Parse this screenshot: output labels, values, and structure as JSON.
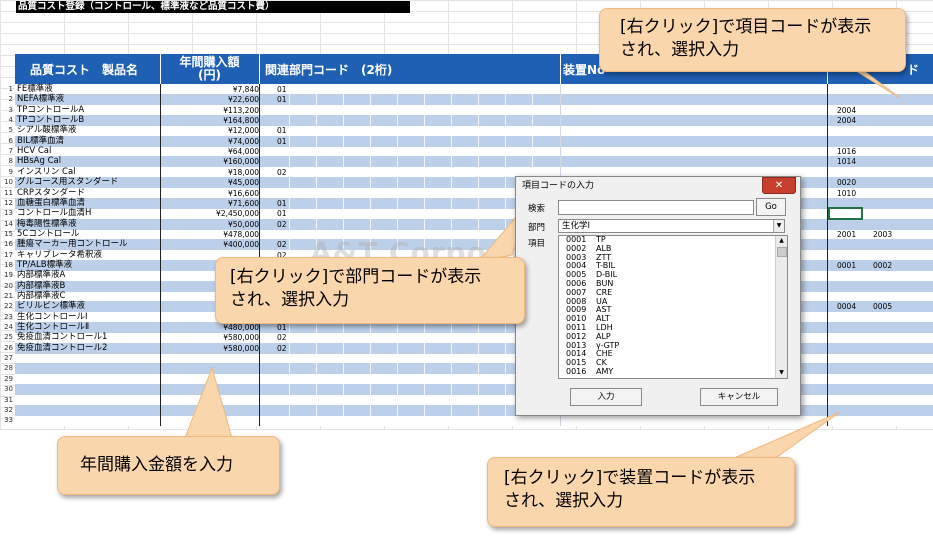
{
  "sheet_title": "品質コスト登録（コントロール、標準液など品質コスト費）",
  "headers": {
    "product": "品質コスト　製品名",
    "amount_line1": "年間購入額",
    "amount_line2": "(円)",
    "dept": "関連部門コード　(2桁)",
    "device": "装置No",
    "item_tail": "ド"
  },
  "rows": [
    {
      "num": "1",
      "name": "FE標準液",
      "amt": "¥7,840",
      "dept": "01",
      "c1": "",
      "c2": ""
    },
    {
      "num": "2",
      "name": "NEFA標準液",
      "amt": "¥22,600",
      "dept": "01",
      "c1": "",
      "c2": ""
    },
    {
      "num": "3",
      "name": "TPコントロールA",
      "amt": "¥113,200",
      "dept": "",
      "c1": "2004",
      "c2": ""
    },
    {
      "num": "4",
      "name": "TPコントロールB",
      "amt": "¥164,800",
      "dept": "",
      "c1": "2004",
      "c2": ""
    },
    {
      "num": "5",
      "name": "シアル酸標準液",
      "amt": "¥12,000",
      "dept": "01",
      "c1": "",
      "c2": ""
    },
    {
      "num": "6",
      "name": "BIL標準血清",
      "amt": "¥74,000",
      "dept": "01",
      "c1": "",
      "c2": ""
    },
    {
      "num": "7",
      "name": "HCV Cal",
      "amt": "¥64,000",
      "dept": "",
      "c1": "1016",
      "c2": ""
    },
    {
      "num": "8",
      "name": "HBsAg Cal",
      "amt": "¥160,000",
      "dept": "",
      "c1": "1014",
      "c2": ""
    },
    {
      "num": "9",
      "name": "インスリン Cal",
      "amt": "¥18,000",
      "dept": "02",
      "c1": "",
      "c2": ""
    },
    {
      "num": "10",
      "name": "グルコース用スタンダード",
      "amt": "¥45,000",
      "dept": "",
      "c1": "0020",
      "c2": ""
    },
    {
      "num": "11",
      "name": "CRPスタンダード",
      "amt": "¥16,600",
      "dept": "",
      "c1": "1010",
      "c2": ""
    },
    {
      "num": "12",
      "name": "血糖蛋白標準血清",
      "amt": "¥71,600",
      "dept": "01",
      "c1": "",
      "c2": ""
    },
    {
      "num": "13",
      "name": "コントロール血清H",
      "amt": "¥2,450,000",
      "dept": "01",
      "c1": "",
      "c2": ""
    },
    {
      "num": "14",
      "name": "梅毒陽性標準液",
      "amt": "¥50,000",
      "dept": "02",
      "c1": "",
      "c2": ""
    },
    {
      "num": "15",
      "name": "5Cコントロール",
      "amt": "¥478,000",
      "dept": "",
      "c1": "2001",
      "c2": "2003"
    },
    {
      "num": "16",
      "name": "腫瘍マーカー用コントロール",
      "amt": "¥400,000",
      "dept": "02",
      "c1": "",
      "c2": ""
    },
    {
      "num": "17",
      "name": "キャリブレータ希釈液",
      "amt": "",
      "dept": "02",
      "c1": "",
      "c2": ""
    },
    {
      "num": "18",
      "name": "TP/ALB標準液",
      "amt": "",
      "dept": "",
      "c1": "0001",
      "c2": "0002"
    },
    {
      "num": "19",
      "name": "内部標準液A",
      "amt": "",
      "dept": "",
      "c1": "",
      "c2": ""
    },
    {
      "num": "20",
      "name": "内部標準液B",
      "amt": "",
      "dept": "",
      "c1": "",
      "c2": ""
    },
    {
      "num": "21",
      "name": "内部標準液C",
      "amt": "",
      "dept": "",
      "c1": "",
      "c2": ""
    },
    {
      "num": "22",
      "name": "ビリルビン標準液",
      "amt": "",
      "dept": "",
      "c1": "0004",
      "c2": "0005"
    },
    {
      "num": "23",
      "name": "生化コントロールⅠ",
      "amt": "",
      "dept": "",
      "c1": "",
      "c2": ""
    },
    {
      "num": "24",
      "name": "生化コントロールⅡ",
      "amt": "¥480,000",
      "dept": "01",
      "c1": "",
      "c2": ""
    },
    {
      "num": "25",
      "name": "免疫血清コントロール1",
      "amt": "¥580,000",
      "dept": "02",
      "c1": "",
      "c2": ""
    },
    {
      "num": "26",
      "name": "免疫血清コントロール2",
      "amt": "¥580,000",
      "dept": "02",
      "c1": "",
      "c2": ""
    },
    {
      "num": "27",
      "name": "",
      "amt": "",
      "dept": "",
      "c1": "",
      "c2": ""
    },
    {
      "num": "28",
      "name": "",
      "amt": "",
      "dept": "",
      "c1": "",
      "c2": ""
    },
    {
      "num": "29",
      "name": "",
      "amt": "",
      "dept": "",
      "c1": "",
      "c2": ""
    },
    {
      "num": "30",
      "name": "",
      "amt": "",
      "dept": "",
      "c1": "",
      "c2": ""
    },
    {
      "num": "31",
      "name": "",
      "amt": "",
      "dept": "",
      "c1": "",
      "c2": ""
    },
    {
      "num": "32",
      "name": "",
      "amt": "",
      "dept": "",
      "c1": "",
      "c2": ""
    },
    {
      "num": "33",
      "name": "",
      "amt": "",
      "dept": "",
      "c1": "",
      "c2": ""
    }
  ],
  "watermark": "A&T Corporation",
  "dialog": {
    "title": "項目コードの入力",
    "close": "✕",
    "search_label": "検索",
    "search_value": "",
    "go": "Go",
    "dept_label": "部門",
    "dept_value": "生化学Ⅰ",
    "items_label": "項目",
    "items": [
      {
        "code": "0001",
        "name": "TP"
      },
      {
        "code": "0002",
        "name": "ALB"
      },
      {
        "code": "0003",
        "name": "ZTT"
      },
      {
        "code": "0004",
        "name": "T-BIL"
      },
      {
        "code": "0005",
        "name": "D-BIL"
      },
      {
        "code": "0006",
        "name": "BUN"
      },
      {
        "code": "0007",
        "name": "CRE"
      },
      {
        "code": "0008",
        "name": "UA"
      },
      {
        "code": "0009",
        "name": "AST"
      },
      {
        "code": "0010",
        "name": "ALT"
      },
      {
        "code": "0011",
        "name": "LDH"
      },
      {
        "code": "0012",
        "name": "ALP"
      },
      {
        "code": "0013",
        "name": "γ-GTP"
      },
      {
        "code": "0014",
        "name": "CHE"
      },
      {
        "code": "0015",
        "name": "CK"
      },
      {
        "code": "0016",
        "name": "AMY"
      }
    ],
    "ok": "入力",
    "cancel": "キャンセル"
  },
  "callouts": {
    "item_code": "[右クリック]で項目コードが表示\nされ、選択入力",
    "dept_code": "[右クリック]で部門コードが表示\nされ、選択入力",
    "amount": "年間購入金額を入力",
    "device_code": "[右クリック]で装置コードが表示\nされ、選択入力"
  },
  "colors": {
    "header": "#1f5fb4",
    "band": "#bdd0e9",
    "callout": "#fad6ad",
    "callout_border": "#f0b77e"
  }
}
